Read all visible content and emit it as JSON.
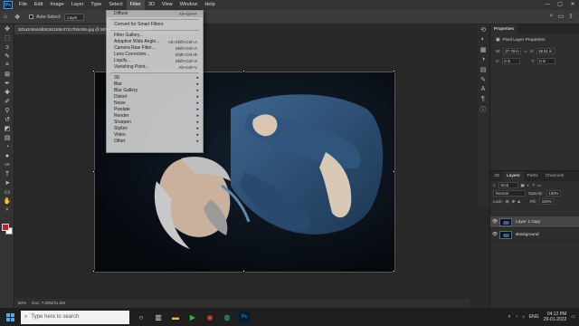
{
  "menubar": {
    "logo": "Ps",
    "items": [
      "File",
      "Edit",
      "Image",
      "Layer",
      "Type",
      "Select",
      "Filter",
      "3D",
      "View",
      "Window",
      "Help"
    ],
    "active_index": 6
  },
  "options": {
    "auto_select_label": "Auto-Select:",
    "auto_select_value": "Layer"
  },
  "document": {
    "tab_label": "3d1a2c6544db0261168e37317b0c80e.jpg @ 50% (Layer 1 copy, RGB/8#) *",
    "zoom": "50%",
    "doc_info": "Doc: 7.00M/21.0M"
  },
  "filter_menu": {
    "items": [
      {
        "label": "Diffuse",
        "shortcut": "Alt+Ctrl+F",
        "highlight": true
      },
      {
        "sep": true
      },
      {
        "label": "Convert for Smart Filters"
      },
      {
        "sep": true
      },
      {
        "label": "Filter Gallery..."
      },
      {
        "label": "Adaptive Wide Angle...",
        "shortcut": "Alt+Shift+Ctrl+A"
      },
      {
        "label": "Camera Raw Filter...",
        "shortcut": "Shift+Ctrl+A"
      },
      {
        "label": "Lens Correction...",
        "shortcut": "Shift+Ctrl+R"
      },
      {
        "label": "Liquify...",
        "shortcut": "Shift+Ctrl+X"
      },
      {
        "label": "Vanishing Point...",
        "shortcut": "Alt+Ctrl+V"
      },
      {
        "sep": true
      },
      {
        "label": "3D",
        "sub": true
      },
      {
        "label": "Blur",
        "sub": true
      },
      {
        "label": "Blur Gallery",
        "sub": true
      },
      {
        "label": "Distort",
        "sub": true
      },
      {
        "label": "Noise",
        "sub": true
      },
      {
        "label": "Pixelate",
        "sub": true
      },
      {
        "label": "Render",
        "sub": true
      },
      {
        "label": "Sharpen",
        "sub": true
      },
      {
        "label": "Stylize",
        "sub": true
      },
      {
        "label": "Video",
        "sub": true
      },
      {
        "label": "Other",
        "sub": true
      }
    ]
  },
  "properties": {
    "tab": "Properties",
    "title": "Pixel Layer Properties",
    "w_label": "W:",
    "w_value": "27.78 in",
    "h_label": "H:",
    "h_value": "18.51 in",
    "x_label": "X:",
    "x_value": "0 in",
    "y_label": "Y:",
    "y_value": "0 in"
  },
  "layers": {
    "tabs": [
      "3D",
      "Layers",
      "Paths",
      "Channels"
    ],
    "active_tab": "Layers",
    "kind_label": "Kind",
    "blend_mode": "Normal",
    "opacity_label": "Opacity:",
    "opacity_value": "100%",
    "lock_label": "Lock:",
    "fill_label": "Fill:",
    "fill_value": "100%",
    "items": [
      {
        "name": "Layer 1 copy",
        "selected": true
      },
      {
        "name": "Background",
        "selected": false
      }
    ]
  },
  "taskbar": {
    "search_placeholder": "Type here to search",
    "lang": "ENG",
    "time": "04:12 PM",
    "date": "29-01-2022"
  }
}
